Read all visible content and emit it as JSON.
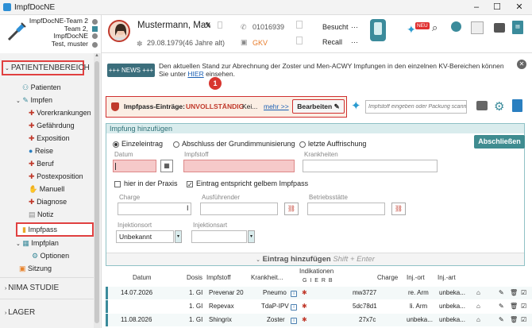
{
  "window": {
    "title": "ImpfDocNE"
  },
  "tenant": {
    "line1": "ImpfDocNE-Team 2",
    "line2": "Team 2,",
    "line3": "ImpfDocNE",
    "line4": "Test, muster"
  },
  "patient": {
    "name": "Mustermann, Max",
    "phone": "01016939",
    "dob": "29.08.1979",
    "age": "(46 Jahre alt)",
    "insurance": "GKV",
    "status1_label": "Besucht",
    "status1_value": "···",
    "status2_label": "Recall",
    "status2_value": "···",
    "dash1": "···",
    "dash2": "···"
  },
  "badge_new": "NEU",
  "sidebar": {
    "section_patient": "PATIENTENBEREICH",
    "items": [
      "Patienten",
      "Impfen",
      "Vorerkrankungen",
      "Gefährdung",
      "Exposition",
      "Reise",
      "Beruf",
      "Postexposition",
      "Manuell",
      "Diagnose",
      "Notiz",
      "Impfpass",
      "Impfplan",
      "Optionen",
      "Sitzung"
    ],
    "section_nima": "NIMA STUDIE",
    "section_lager": "LAGER"
  },
  "news": {
    "badge": "+++ NEWS +++",
    "text": "Den aktuellen Stand zur Abrechnung der Zoster und Men-ACWY Impfungen in den einzelnen KV-Bereichen können Sie unter",
    "link": "HIER",
    "text2": "einsehen."
  },
  "marker": "1",
  "warn": {
    "label": "Impfpass-Einträge:",
    "status": "UNVOLLSTÄNDIG",
    "ellipsis": "Kei...",
    "more": "mehr >>",
    "edit": "Bearbeiten"
  },
  "search": {
    "placeholder": "Impfstoff eingeben oder Packung scannen"
  },
  "panel": {
    "title": "Impfung hinzufügen",
    "radio1": "Einzeleintrag",
    "radio2": "Abschluss der Grundimmunisierung",
    "radio3": "letzte Auffrischung",
    "finish": "Abschließen",
    "lbl_datum": "Datum",
    "lbl_impfstoff": "Impfstoff",
    "lbl_krankheiten": "Krankheiten",
    "chk1": "hier in der Praxis",
    "chk2": "Eintrag entspricht gelbem Impfpass",
    "lbl_charge": "Charge",
    "lbl_ausf": "Ausführender",
    "lbl_betrieb": "Betriebsstätte",
    "lbl_inj1": "Injektionsort",
    "inj1_value": "Unbekannt",
    "lbl_inj2": "Injektionsart",
    "add": "Eintrag hinzufügen",
    "shortcut": "Shift + Enter"
  },
  "table": {
    "headers": [
      "Datum",
      "Dosis",
      "Impfstoff",
      "Krankheit...",
      "Indikationen",
      "Charge",
      "Inj.-ort",
      "Inj.-art"
    ],
    "ind_letters": "G I E R B",
    "rows": [
      {
        "datum": "14.07.2026",
        "dosis": "1. GI",
        "impfstoff": "Prevenar 20",
        "krankheit": "Pneumo",
        "charge": "mw3727",
        "injort": "re. Arm",
        "injart": "unbeka..."
      },
      {
        "datum": "",
        "dosis": "1. GI",
        "impfstoff": "Repevax",
        "krankheit": "TdaP-IPV",
        "charge": "5dc78d1",
        "injort": "li. Arm",
        "injart": "unbeka..."
      },
      {
        "datum": "11.08.2026",
        "dosis": "1. GI",
        "impfstoff": "Shingrix",
        "krankheit": "Zoster",
        "charge": "27x7c",
        "injort": "unbeka...",
        "injart": "unbeka..."
      }
    ]
  }
}
